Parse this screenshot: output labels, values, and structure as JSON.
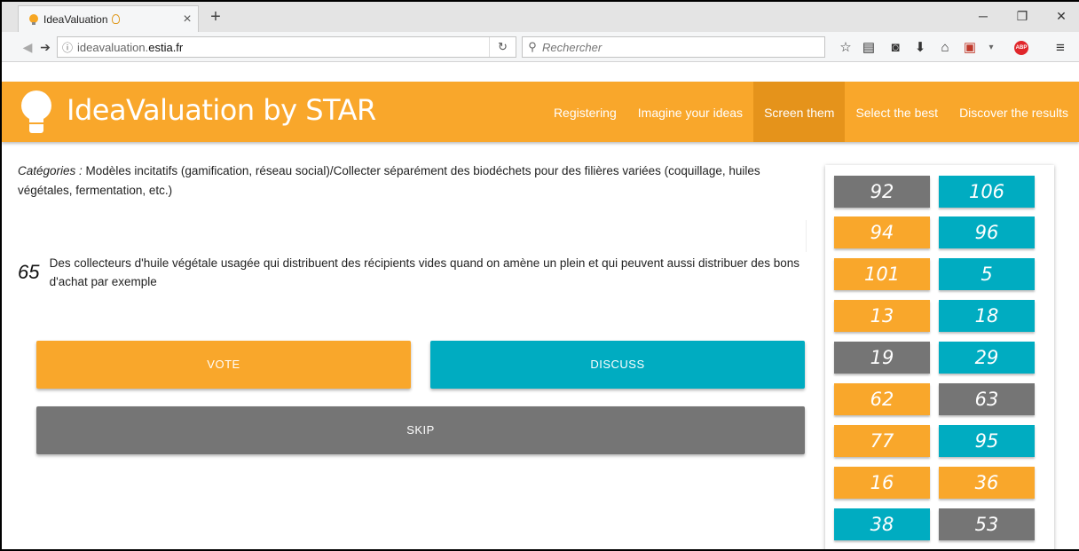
{
  "browser": {
    "tab_title": "IdeaValuation",
    "url_prefix": "ideavaluation.",
    "url_domain": "estia.fr",
    "search_placeholder": "Rechercher",
    "icons": [
      "back-icon",
      "forward-icon",
      "info-icon",
      "reload-icon",
      "search-icon",
      "bookmark-star-icon",
      "reading-list-icon",
      "pocket-icon",
      "download-icon",
      "home-icon",
      "pdf-icon",
      "adblock-icon",
      "menu-icon"
    ],
    "window_controls": [
      "─",
      "❐",
      "✕"
    ],
    "abp_label": "ABP"
  },
  "header": {
    "title": "IdeaValuation by STAR",
    "menu": [
      {
        "label": "Registering",
        "active": false
      },
      {
        "label": "Imagine your ideas",
        "active": false
      },
      {
        "label": "Screen them",
        "active": true
      },
      {
        "label": "Select the best",
        "active": false
      },
      {
        "label": "Discover the results",
        "active": false
      }
    ]
  },
  "main": {
    "categories_label": "Catégories :",
    "categories_text": " Modèles incitatifs (gamification, réseau social)/Collecter séparément des biodéchets pour des filières variées (coquillage, huiles végétales, fermentation, etc.)",
    "idea_number": "65",
    "idea_text": "Des collecteurs d'huile végétale usagée qui distribuent des récipients vides quand on amène un plein et qui peuvent aussi distribuer des bons d'achat par exemple",
    "vote_label": "VOTE",
    "discuss_label": "DISCUSS",
    "skip_label": "SKIP"
  },
  "side": {
    "colors": {
      "orange": "#f9a72b",
      "teal": "#00acc1",
      "grey": "#757575"
    },
    "chips": [
      {
        "value": "92",
        "color": "grey"
      },
      {
        "value": "106",
        "color": "teal"
      },
      {
        "value": "94",
        "color": "orange"
      },
      {
        "value": "96",
        "color": "teal"
      },
      {
        "value": "101",
        "color": "orange"
      },
      {
        "value": "5",
        "color": "teal"
      },
      {
        "value": "13",
        "color": "orange"
      },
      {
        "value": "18",
        "color": "teal"
      },
      {
        "value": "19",
        "color": "grey"
      },
      {
        "value": "29",
        "color": "teal"
      },
      {
        "value": "62",
        "color": "orange"
      },
      {
        "value": "63",
        "color": "grey"
      },
      {
        "value": "77",
        "color": "orange"
      },
      {
        "value": "95",
        "color": "teal"
      },
      {
        "value": "16",
        "color": "orange"
      },
      {
        "value": "36",
        "color": "orange"
      },
      {
        "value": "38",
        "color": "teal"
      },
      {
        "value": "53",
        "color": "grey"
      }
    ]
  }
}
